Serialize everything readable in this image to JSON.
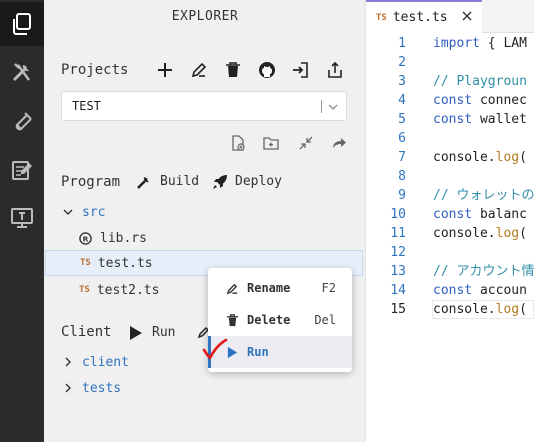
{
  "activity_bar": {
    "items": [
      {
        "icon": "files-icon"
      },
      {
        "icon": "tools-icon"
      },
      {
        "icon": "test-tube-icon"
      },
      {
        "icon": "tutorials-icon"
      },
      {
        "icon": "monitor-icon"
      }
    ]
  },
  "explorer": {
    "title": "EXPLORER",
    "projects": {
      "label": "Projects",
      "selected_project": "TEST"
    },
    "program": {
      "label": "Program",
      "build_label": "Build",
      "deploy_label": "Deploy"
    },
    "tree": {
      "src_folder": "src",
      "files": [
        {
          "name": "lib.rs",
          "badge": "rust-icon"
        },
        {
          "name": "test.ts",
          "badge": "TS"
        },
        {
          "name": "test2.ts",
          "badge": "TS"
        }
      ]
    },
    "client": {
      "label": "Client",
      "run_label": "Run",
      "folders": [
        "client",
        "tests"
      ]
    }
  },
  "context_menu": {
    "items": [
      {
        "label": "Rename",
        "shortcut": "F2"
      },
      {
        "label": "Delete",
        "shortcut": "Del"
      },
      {
        "label": "Run",
        "shortcut": ""
      }
    ]
  },
  "editor": {
    "tab": {
      "badge": "TS",
      "label": "test.ts"
    },
    "lines": [
      {
        "n": "1",
        "text": "import { LAM"
      },
      {
        "n": "2",
        "text": ""
      },
      {
        "n": "3",
        "text": "// Playgroun"
      },
      {
        "n": "4",
        "text": "const connec"
      },
      {
        "n": "5",
        "text": "const wallet"
      },
      {
        "n": "6",
        "text": ""
      },
      {
        "n": "7",
        "text": "console.log("
      },
      {
        "n": "8",
        "text": ""
      },
      {
        "n": "9",
        "text": "// ウォレットの"
      },
      {
        "n": "10",
        "text": "const balanc"
      },
      {
        "n": "11",
        "text": "console.log("
      },
      {
        "n": "12",
        "text": ""
      },
      {
        "n": "13",
        "text": "// アカウント情"
      },
      {
        "n": "14",
        "text": "const accoun"
      },
      {
        "n": "15",
        "text": "console.log("
      }
    ]
  },
  "colors": {
    "accent": "#2f74c0",
    "ts_badge": "#c0702f",
    "annotation": "#e01818"
  }
}
